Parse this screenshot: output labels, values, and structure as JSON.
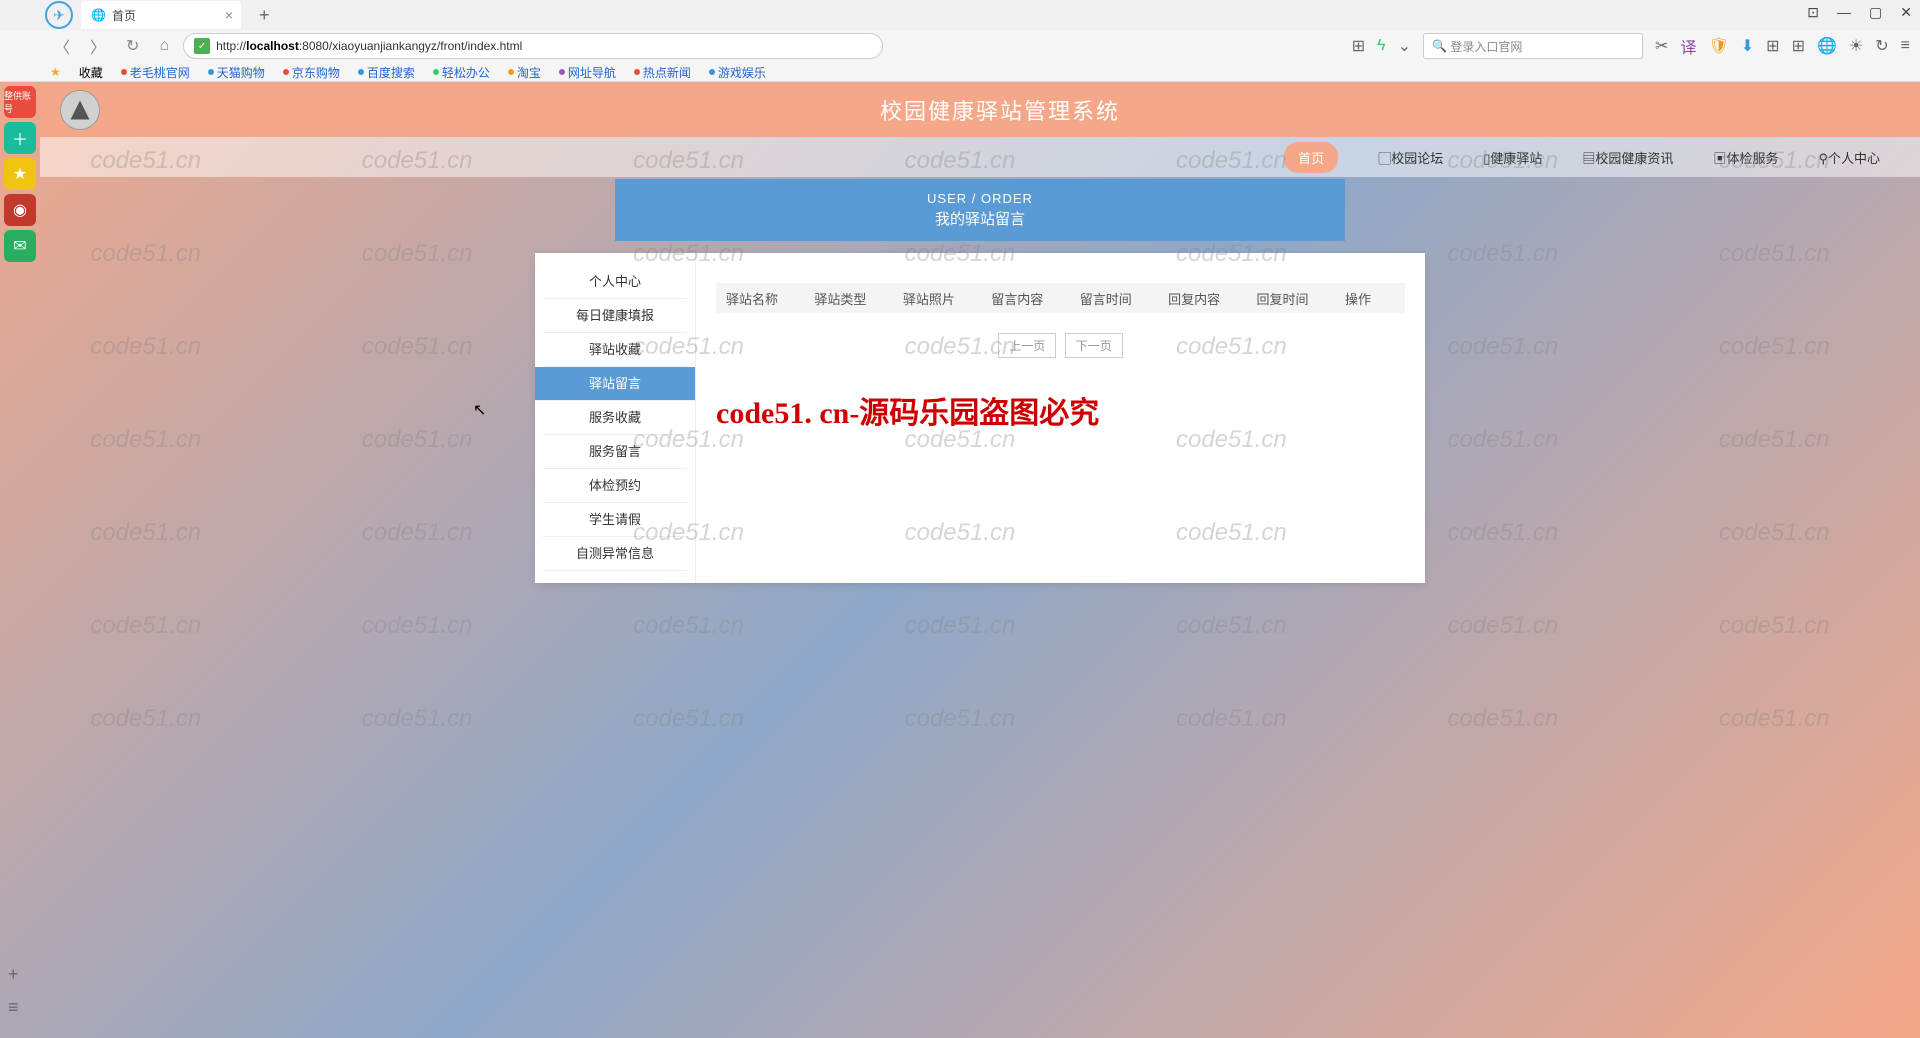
{
  "browser": {
    "tab_title": "首页",
    "address": {
      "prefix": "http://",
      "host": "localhost",
      "rest": ":8080/xiaoyuanjiankangyz/front/index.html"
    },
    "search_placeholder": "登录入口官网",
    "win": {
      "min": "—",
      "max": "▢",
      "close": "✕",
      "extra": "⊡"
    }
  },
  "bookmarks": {
    "fav_label": "收藏",
    "items": [
      "老毛桃官网",
      "天猫购物",
      "京东购物",
      "百度搜索",
      "轻松办公",
      "淘宝",
      "网址导航",
      "热点新闻",
      "游戏娱乐"
    ]
  },
  "rail": {
    "badge": "整供账号"
  },
  "site": {
    "title": "校园健康驿站管理系统"
  },
  "nav": [
    "首页",
    "校园论坛",
    "健康驿站",
    "校园健康资讯",
    "体检服务",
    "个人中心"
  ],
  "banner": {
    "en": "USER / ORDER",
    "cn": "我的驿站留言"
  },
  "sidemenu": [
    "个人中心",
    "每日健康填报",
    "驿站收藏",
    "驿站留言",
    "服务收藏",
    "服务留言",
    "体检预约",
    "学生请假",
    "自测异常信息"
  ],
  "table": {
    "headers": [
      "驿站名称",
      "驿站类型",
      "驿站照片",
      "留言内容",
      "留言时间",
      "回复内容",
      "回复时间",
      "操作"
    ]
  },
  "pager": {
    "prev": "上一页",
    "next": "下一页"
  },
  "watermark_big": "code51. cn-源码乐园盗图必究",
  "wm": "code51.cn"
}
